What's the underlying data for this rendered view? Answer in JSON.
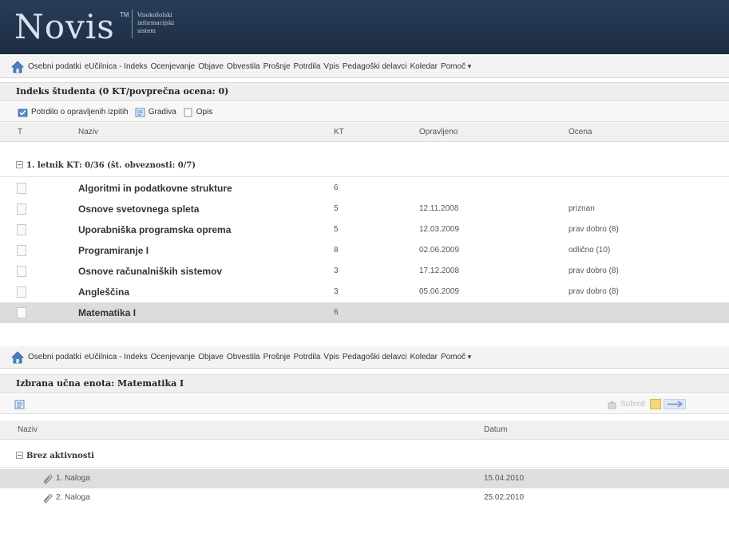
{
  "brand": {
    "name": "Novis",
    "tm": "TM",
    "subtitle": "Visokošolski informacijski sistem"
  },
  "nav": {
    "items": [
      "Osebni podatki",
      "eUčilnica - Indeks",
      "Ocenjevanje",
      "Objave",
      "Obvestila",
      "Prošnje",
      "Potrdila",
      "Vpis",
      "Pedagoški delavci",
      "Koledar"
    ],
    "help": "Pomoč"
  },
  "index": {
    "title": "Indeks študenta (0 KT/povprečna ocena: 0)",
    "toolbar": {
      "certificate": "Potrdilo o opravljenih izpitih",
      "materials": "Gradiva",
      "description": "Opis"
    },
    "columns": {
      "type": "T",
      "name": "Naziv",
      "kt": "KT",
      "passed": "Opravljeno",
      "grade": "Ocena"
    },
    "group": "1. letnik KT: 0/36 (št. obveznosti: 0/7)",
    "rows": [
      {
        "name": "Algoritmi in podatkovne strukture",
        "kt": "6",
        "date": "",
        "grade": ""
      },
      {
        "name": "Osnove svetovnega spleta",
        "kt": "5",
        "date": "12.11.2008",
        "grade": "priznan"
      },
      {
        "name": "Uporabniška programska oprema",
        "kt": "5",
        "date": "12.03.2009",
        "grade": "prav dobro (8)"
      },
      {
        "name": "Programiranje I",
        "kt": "8",
        "date": "02.06.2009",
        "grade": "odlično (10)"
      },
      {
        "name": "Osnove računalniških sistemov",
        "kt": "3",
        "date": "17.12.2008",
        "grade": "prav dobro (8)"
      },
      {
        "name": "Angleščina",
        "kt": "3",
        "date": "05.06.2009",
        "grade": "prav dobro (8)"
      },
      {
        "name": "Matematika I",
        "kt": "6",
        "date": "",
        "grade": ""
      }
    ]
  },
  "unit": {
    "title": "Izbrana učna enota: Matematika I",
    "submit": "Submit",
    "columns": {
      "name": "Naziv",
      "date": "Datum"
    },
    "group": "Brez aktivnosti",
    "rows": [
      {
        "name": "1. Naloga",
        "date": "15.04.2010"
      },
      {
        "name": "2. Naloga",
        "date": "25.02.2010"
      }
    ]
  },
  "colors": {
    "header_bg": "#1f3048",
    "selected_row": "#dcdcdc",
    "toolbar_bg": "#f3f3f3"
  }
}
